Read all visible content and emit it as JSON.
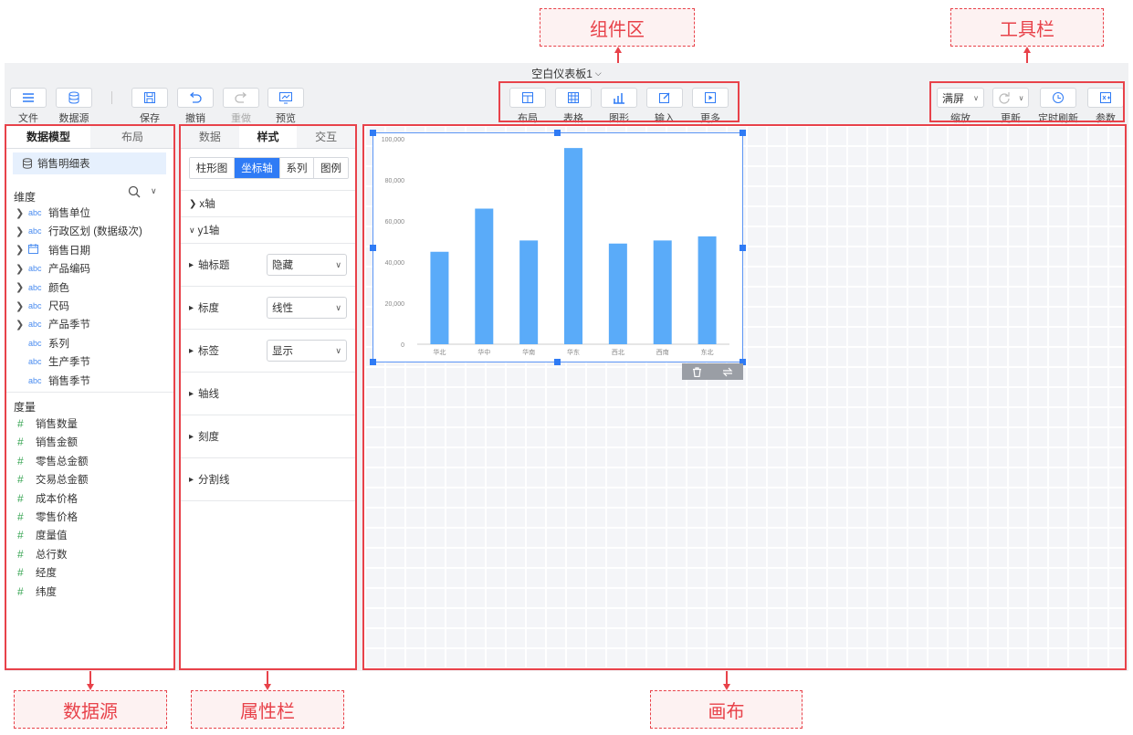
{
  "annotations": {
    "component_area": "组件区",
    "toolbar": "工具栏",
    "data_source": "数据源",
    "property_bar": "属性栏",
    "canvas": "画布"
  },
  "title": "空白仪表板1",
  "toolbar_left": [
    {
      "label": "文件",
      "icon": "menu-icon"
    },
    {
      "label": "数据源",
      "icon": "database-icon"
    },
    {
      "label": "保存",
      "icon": "save-icon"
    },
    {
      "label": "撤销",
      "icon": "undo-icon"
    },
    {
      "label": "重做",
      "icon": "redo-icon"
    },
    {
      "label": "预览",
      "icon": "preview-icon"
    }
  ],
  "toolbar_center": [
    {
      "label": "布局",
      "icon": "layout-icon"
    },
    {
      "label": "表格",
      "icon": "table-icon"
    },
    {
      "label": "图形",
      "icon": "chart-icon"
    },
    {
      "label": "输入",
      "icon": "edit-icon"
    },
    {
      "label": "更多",
      "icon": "more-icon"
    }
  ],
  "toolbar_right": {
    "zoom_value": "满屏",
    "zoom_label": "缩放",
    "update_label": "更新",
    "timer_label": "定时刷新",
    "param_label": "参数"
  },
  "left_panel": {
    "tabs": [
      "数据模型",
      "布局"
    ],
    "dataset": "销售明细表",
    "dim_title": "维度",
    "dimensions": [
      {
        "name": "销售单位",
        "expandable": true,
        "type": "abc"
      },
      {
        "name": "行政区划 (数据级次)",
        "expandable": true,
        "type": "abc"
      },
      {
        "name": "销售日期",
        "expandable": true,
        "type": "date"
      },
      {
        "name": "产品编码",
        "expandable": true,
        "type": "abc"
      },
      {
        "name": "颜色",
        "expandable": true,
        "type": "abc"
      },
      {
        "name": "尺码",
        "expandable": true,
        "type": "abc"
      },
      {
        "name": "产品季节",
        "expandable": true,
        "type": "abc"
      },
      {
        "name": "系列",
        "expandable": false,
        "type": "abc"
      },
      {
        "name": "生产季节",
        "expandable": false,
        "type": "abc"
      },
      {
        "name": "销售季节",
        "expandable": false,
        "type": "abc"
      }
    ],
    "measure_title": "度量",
    "measures": [
      "销售数量",
      "销售金额",
      "零售总金额",
      "交易总金额",
      "成本价格",
      "零售价格",
      "度量值",
      "总行数",
      "经度",
      "纬度"
    ]
  },
  "prop_panel": {
    "tabs": [
      "数据",
      "样式",
      "交互"
    ],
    "subtabs": [
      "柱形图",
      "坐标轴",
      "系列",
      "图例"
    ],
    "x_axis": "x轴",
    "y1_axis": "y1轴",
    "rows": [
      {
        "label": "轴标题",
        "value": "隐藏"
      },
      {
        "label": "标度",
        "value": "线性"
      },
      {
        "label": "标签",
        "value": "显示"
      },
      {
        "label": "轴线",
        "value": ""
      },
      {
        "label": "刻度",
        "value": ""
      },
      {
        "label": "分割线",
        "value": ""
      }
    ]
  },
  "chart_data": {
    "type": "bar",
    "categories": [
      "华北",
      "华中",
      "华南",
      "华东",
      "西北",
      "西南",
      "东北"
    ],
    "values": [
      45000,
      66000,
      50500,
      95500,
      49000,
      50500,
      52500
    ],
    "ylim": [
      0,
      100000
    ],
    "yticks": [
      "0",
      "20,000",
      "40,000",
      "60,000",
      "80,000",
      "100,000"
    ],
    "bar_color": "#5aabf9"
  }
}
